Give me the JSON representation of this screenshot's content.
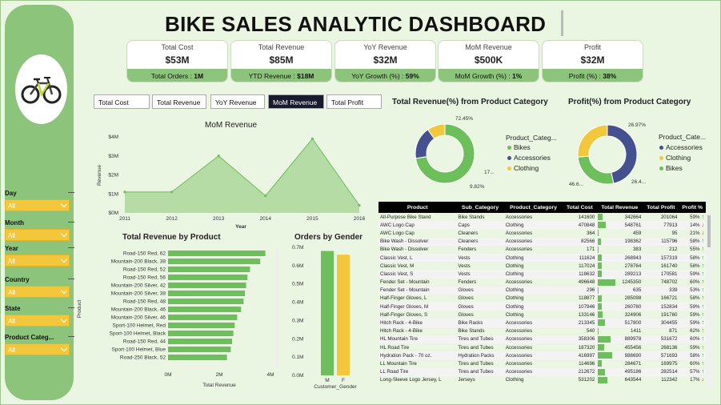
{
  "title": "BIKE SALES ANALYTIC DASHBOARD",
  "kpis": [
    {
      "label": "Total Cost",
      "value": "$53M",
      "foot_label": "Total Orders : ",
      "foot_value": "1M"
    },
    {
      "label": "Total Revenue",
      "value": "$85M",
      "foot_label": "YTD Revenue : ",
      "foot_value": "$18M"
    },
    {
      "label": "YoY Revenue",
      "value": "$32M",
      "foot_label": "YoY Growth (%) : ",
      "foot_value": "59%"
    },
    {
      "label": "MoM Revenue",
      "value": "$500K",
      "foot_label": "MoM Growth (%) : ",
      "foot_value": "1%"
    },
    {
      "label": "Profit",
      "value": "$32M",
      "foot_label": "Profit (%) : ",
      "foot_value": "38%"
    }
  ],
  "tabs": [
    "Total Cost",
    "Total Revenue",
    "YoY Revenue",
    "MoM Revenue",
    "Total Profit"
  ],
  "active_tab": "MoM Revenue",
  "slicers": [
    {
      "label": "Day",
      "value": "All"
    },
    {
      "label": "Month",
      "value": "All"
    },
    {
      "label": "Year",
      "value": "All"
    },
    {
      "label": "Country",
      "value": "All"
    },
    {
      "label": "State",
      "value": "All"
    },
    {
      "label": "Product Categ...",
      "value": "All"
    }
  ],
  "colors": {
    "green": "#6cbf5a",
    "area": "#b6dca6",
    "yellow": "#f3c73c",
    "navy": "#44508f",
    "sidebar": "#8dc47b"
  },
  "chart_data": [
    {
      "type": "area",
      "title": "MoM Revenue",
      "xlabel": "Year",
      "ylabel": "Revenue",
      "x": [
        2011,
        2012,
        2013,
        2014,
        2015,
        2016
      ],
      "values": [
        1.1,
        1.1,
        3.0,
        0.9,
        3.9,
        0.4
      ],
      "ylim": [
        0,
        4
      ],
      "yticks": [
        "$0M",
        "$1M",
        "$2M",
        "$3M",
        "$4M"
      ]
    },
    {
      "type": "bar",
      "orientation": "horizontal",
      "title": "Total  Revenue by Product",
      "xlabel": "Total Revenue",
      "ylabel": "Product",
      "categories": [
        "Road-150 Red, 62",
        "Mountain-200 Black, 38",
        "Road-150 Red, 52",
        "Road-150 Red, 56",
        "Mountain-200 Silver, 42",
        "Mountain-200 Silver, 38",
        "Road-150 Red, 48",
        "Mountain-200 Black, 46",
        "Mountain-200 Silver, 46",
        "Sport-100 Helmet, Red",
        "Sport-100 Helmet, Black",
        "Road-150 Red, 44",
        "Sport-100 Helmet, Blue",
        "Road-250 Black, 52"
      ],
      "values": [
        3.8,
        3.6,
        3.2,
        3.1,
        3.05,
        3.0,
        2.95,
        2.85,
        2.7,
        2.6,
        2.55,
        2.5,
        2.45,
        2.3
      ],
      "xticks": [
        "0M",
        "2M",
        "4M"
      ],
      "xlim": [
        0,
        4
      ]
    },
    {
      "type": "bar",
      "title": "Orders by Gender",
      "xlabel": "Customer_Gender",
      "categories": [
        "M",
        "F"
      ],
      "values": [
        0.68,
        0.66
      ],
      "ylim": [
        0,
        0.7
      ],
      "yticks": [
        "0.0M",
        "0.1M",
        "0.2M",
        "0.3M",
        "0.4M",
        "0.5M",
        "0.6M",
        "0.7M"
      ]
    },
    {
      "type": "pie",
      "title": "Total Revenue(%) from Product Category",
      "legend_title": "Product_Categ...",
      "labels": [
        "Bikes",
        "Accessories",
        "Clothing"
      ],
      "values": [
        72.45,
        17.73,
        9.82
      ],
      "data_labels": [
        "72.45%",
        "17...",
        "9.82%"
      ]
    },
    {
      "type": "pie",
      "title": "Profit(%) from Product Category",
      "legend_title": "Product_Cate...",
      "labels": [
        "Accessories",
        "Clothing",
        "Bikes"
      ],
      "values": [
        46.6,
        26.97,
        26.4
      ],
      "data_labels": [
        "46.6...",
        "26.97%",
        "26.4..."
      ]
    },
    {
      "type": "table",
      "columns": [
        "Product",
        "Sub_Category",
        "Product_Category",
        "Total Cost",
        "Total Revenue",
        "Total Profit",
        "Profit %"
      ],
      "rows": [
        [
          "All-Purpose Bike Stand",
          "Bike Stands",
          "Accessories",
          "141600",
          "342664",
          "201064",
          "59%",
          "up"
        ],
        [
          "AWC Logo Cap",
          "Caps",
          "Clothing",
          "470848",
          "548761",
          "77913",
          "14%",
          "down"
        ],
        [
          "AWC Logo Cap",
          "Cleaners",
          "Accessories",
          "364",
          "459",
          "95",
          "21%",
          "down"
        ],
        [
          "Bike Wash - Dissolver",
          "Cleaners",
          "Accessories",
          "82566",
          "198362",
          "115796",
          "58%",
          "up"
        ],
        [
          "Bike Wash - Dissolver",
          "Fenders",
          "Accessories",
          "171",
          "383",
          "212",
          "55%",
          "up"
        ],
        [
          "Classic Vest, L",
          "Vests",
          "Clothing",
          "111624",
          "268943",
          "157319",
          "58%",
          "up"
        ],
        [
          "Classic Vest, M",
          "Vests",
          "Clothing",
          "117024",
          "278764",
          "161740",
          "58%",
          "up"
        ],
        [
          "Classic Vest, S",
          "Vests",
          "Clothing",
          "118632",
          "289213",
          "170581",
          "59%",
          "up"
        ],
        [
          "Fender Set - Mountain",
          "Fenders",
          "Accessories",
          "496648",
          "1245350",
          "748702",
          "60%",
          "up"
        ],
        [
          "Fender Set - Mountain",
          "Gloves",
          "Clothing",
          "296",
          "635",
          "339",
          "53%",
          "up"
        ],
        [
          "Half-Finger Gloves, L",
          "Gloves",
          "Clothing",
          "118877",
          "285098",
          "166721",
          "58%",
          "up"
        ],
        [
          "Half-Finger Gloves, M",
          "Gloves",
          "Clothing",
          "107946",
          "260780",
          "152834",
          "59%",
          "up"
        ],
        [
          "Half-Finger Gloves, S",
          "Gloves",
          "Clothing",
          "133146",
          "324906",
          "191760",
          "59%",
          "up"
        ],
        [
          "Hitch Rack - 4-Bike",
          "Bike Racks",
          "Accessories",
          "213345",
          "517800",
          "304455",
          "59%",
          "up"
        ],
        [
          "Hitch Rack - 4-Bike",
          "Bike Stands",
          "Accessories",
          "540",
          "1411",
          "871",
          "62%",
          "up"
        ],
        [
          "HL Mountain Tire",
          "Tires and Tubes",
          "Accessories",
          "358306",
          "889978",
          "531672",
          "60%",
          "up"
        ],
        [
          "HL Road Tire",
          "Tires and Tubes",
          "Accessories",
          "187320",
          "455456",
          "268136",
          "59%",
          "up"
        ],
        [
          "Hydration Pack - 70 oz.",
          "Hydration Packs",
          "Accessories",
          "416997",
          "988690",
          "571693",
          "58%",
          "up"
        ],
        [
          "LL Mountain Tire",
          "Tires and Tubes",
          "Accessories",
          "114696",
          "284671",
          "169975",
          "60%",
          "up"
        ],
        [
          "LL Road Tire",
          "Tires and Tubes",
          "Accessories",
          "212672",
          "495186",
          "282514",
          "57%",
          "up"
        ],
        [
          "Long-Sleeve Logo Jersey, L",
          "Jerseys",
          "Clothing",
          "531202",
          "643544",
          "112342",
          "17%",
          "down"
        ]
      ]
    }
  ]
}
